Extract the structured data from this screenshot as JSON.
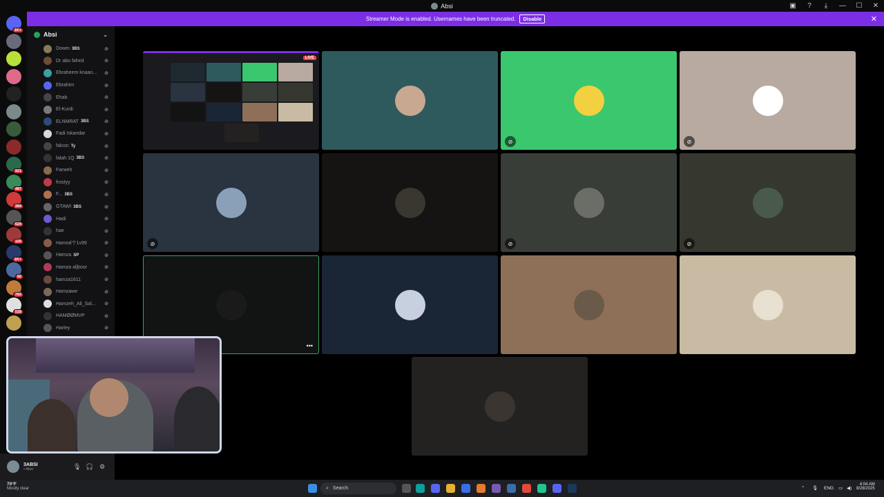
{
  "window": {
    "title": "Absi"
  },
  "banner": {
    "text": "Streamer Mode is enabled. Usernames have been truncated.",
    "button": "Disable"
  },
  "server_badges": [
    "1K+",
    "",
    "",
    "",
    "",
    "",
    "",
    "",
    "921",
    "487",
    "394",
    "624",
    "125",
    "1K+",
    "92",
    "783",
    "518",
    ""
  ],
  "channel": {
    "name": "Absi"
  },
  "users": [
    {
      "name": "Dowm",
      "tag": "3BS",
      "color": "#8b7a55"
    },
    {
      "name": "Dr abo fahed",
      "tag": "",
      "color": "#6b4d3a"
    },
    {
      "name": "Ebraheem knaan...",
      "tag": "",
      "color": "#3aa0a0"
    },
    {
      "name": "Ebrahim",
      "tag": "",
      "color": "#5865f2"
    },
    {
      "name": "Ehab",
      "tag": "",
      "color": "#444"
    },
    {
      "name": "El-Kurdi",
      "tag": "",
      "color": "#7a7a7a"
    },
    {
      "name": "ELNMRAT",
      "tag": "3BS",
      "color": "#2d4a7a"
    },
    {
      "name": "Fadi Iskandar",
      "tag": "",
      "color": "#d8d8d8"
    },
    {
      "name": "falcon",
      "tag": "Ty",
      "color": "#444"
    },
    {
      "name": "falah 1Q",
      "tag": "3BS",
      "color": "#333"
    },
    {
      "name": "Farweh",
      "tag": "",
      "color": "#8a6a4a"
    },
    {
      "name": "frostyy",
      "tag": "",
      "color": "#c03a4a"
    },
    {
      "name": "F...",
      "tag": "3BS",
      "color": "#b07050"
    },
    {
      "name": "GTAWI",
      "tag": "3BS",
      "color": "#666"
    },
    {
      "name": "Hadi",
      "tag": "",
      "color": "#6a5acd"
    },
    {
      "name": "hae",
      "tag": "",
      "color": "#333"
    },
    {
      "name": "Hamod个1v99",
      "tag": "",
      "color": "#8a5a4a"
    },
    {
      "name": "Hamza",
      "tag": "SP",
      "color": "#555"
    },
    {
      "name": "Hamza aljboor",
      "tag": "",
      "color": "#b03a5a"
    },
    {
      "name": "hamza1611",
      "tag": "",
      "color": "#6a4a3a"
    },
    {
      "name": "Hamzawe",
      "tag": "",
      "color": "#7a6a5a"
    },
    {
      "name": "Hamzeh_Ali_Sal...",
      "tag": "",
      "color": "#ddd"
    },
    {
      "name": "HAMØØMVP",
      "tag": "",
      "color": "#333"
    },
    {
      "name": "Harley",
      "tag": "",
      "color": "#555"
    }
  ],
  "tiles": [
    {
      "bg": "#1a1a1f",
      "avatar": "",
      "mic": false,
      "stream": true
    },
    {
      "bg": "#2e5a5e",
      "avatar": "#c8a890",
      "mic": false
    },
    {
      "bg": "#3ac76e",
      "avatar": "#f2d040",
      "mic": true
    },
    {
      "bg": "#b8aaa0",
      "avatar": "#ffffff",
      "mic": true
    },
    {
      "bg": "#2a3340",
      "avatar": "#8aa0b8",
      "mic": true
    },
    {
      "bg": "#161412",
      "avatar": "#3a3630",
      "mic": false
    },
    {
      "bg": "#393d38",
      "avatar": "#6a6e66",
      "mic": true
    },
    {
      "bg": "#36382f",
      "avatar": "#4a5a4a",
      "mic": true
    },
    {
      "bg": "#121313",
      "avatar": "#1a1a1a",
      "mic": false,
      "selected": true
    },
    {
      "bg": "#1a2636",
      "avatar": "#c8d0e0",
      "mic": false
    },
    {
      "bg": "#8e7058",
      "avatar": "#6a5a4a",
      "mic": false
    },
    {
      "bg": "#c9bba3",
      "avatar": "#e8e0d0",
      "mic": false
    },
    {
      "bg": "#242220",
      "avatar": "#3a3530",
      "mic": false
    }
  ],
  "stream": {
    "live_label": "LIVE"
  },
  "user_panel": {
    "name": "3ABSI",
    "status": "• Absi"
  },
  "taskbar": {
    "weather_temp": "70°F",
    "weather_text": "Mostly clear",
    "search_placeholder": "Search",
    "lang": "ENG",
    "time": "4:04 AM",
    "date": "8/28/2025"
  },
  "colors": {
    "accent": "#7c2ee6",
    "selected_border": "#3ba55d"
  }
}
